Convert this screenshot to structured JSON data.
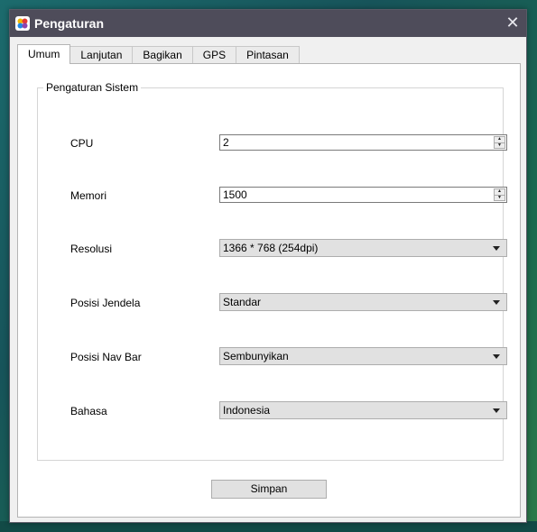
{
  "window": {
    "title": "Pengaturan",
    "close_glyph": "✕"
  },
  "tabs": [
    {
      "label": "Umum",
      "active": true
    },
    {
      "label": "Lanjutan",
      "active": false
    },
    {
      "label": "Bagikan",
      "active": false
    },
    {
      "label": "GPS",
      "active": false
    },
    {
      "label": "Pintasan",
      "active": false
    }
  ],
  "group": {
    "title": "Pengaturan Sistem"
  },
  "fields": {
    "cpu": {
      "label": "CPU",
      "value": "2"
    },
    "memory": {
      "label": "Memori",
      "value": "1500"
    },
    "resolution": {
      "label": "Resolusi",
      "value": "1366 * 768 (254dpi)"
    },
    "window_position": {
      "label": "Posisi Jendela",
      "value": "Standar"
    },
    "navbar_position": {
      "label": "Posisi Nav Bar",
      "value": "Sembunyikan"
    },
    "language": {
      "label": "Bahasa",
      "value": "Indonesia"
    }
  },
  "buttons": {
    "save": "Simpan"
  },
  "icons": {
    "app": "app-logo-icon",
    "close": "close-icon",
    "spin_up": "spin-up-icon",
    "spin_down": "spin-down-icon",
    "dropdown": "chevron-down-icon"
  },
  "colors": {
    "titlebar": "#4e4c5a",
    "window_bg": "#f0f0f0",
    "panel_bg": "#ffffff",
    "control_bg": "#e1e1e1"
  }
}
